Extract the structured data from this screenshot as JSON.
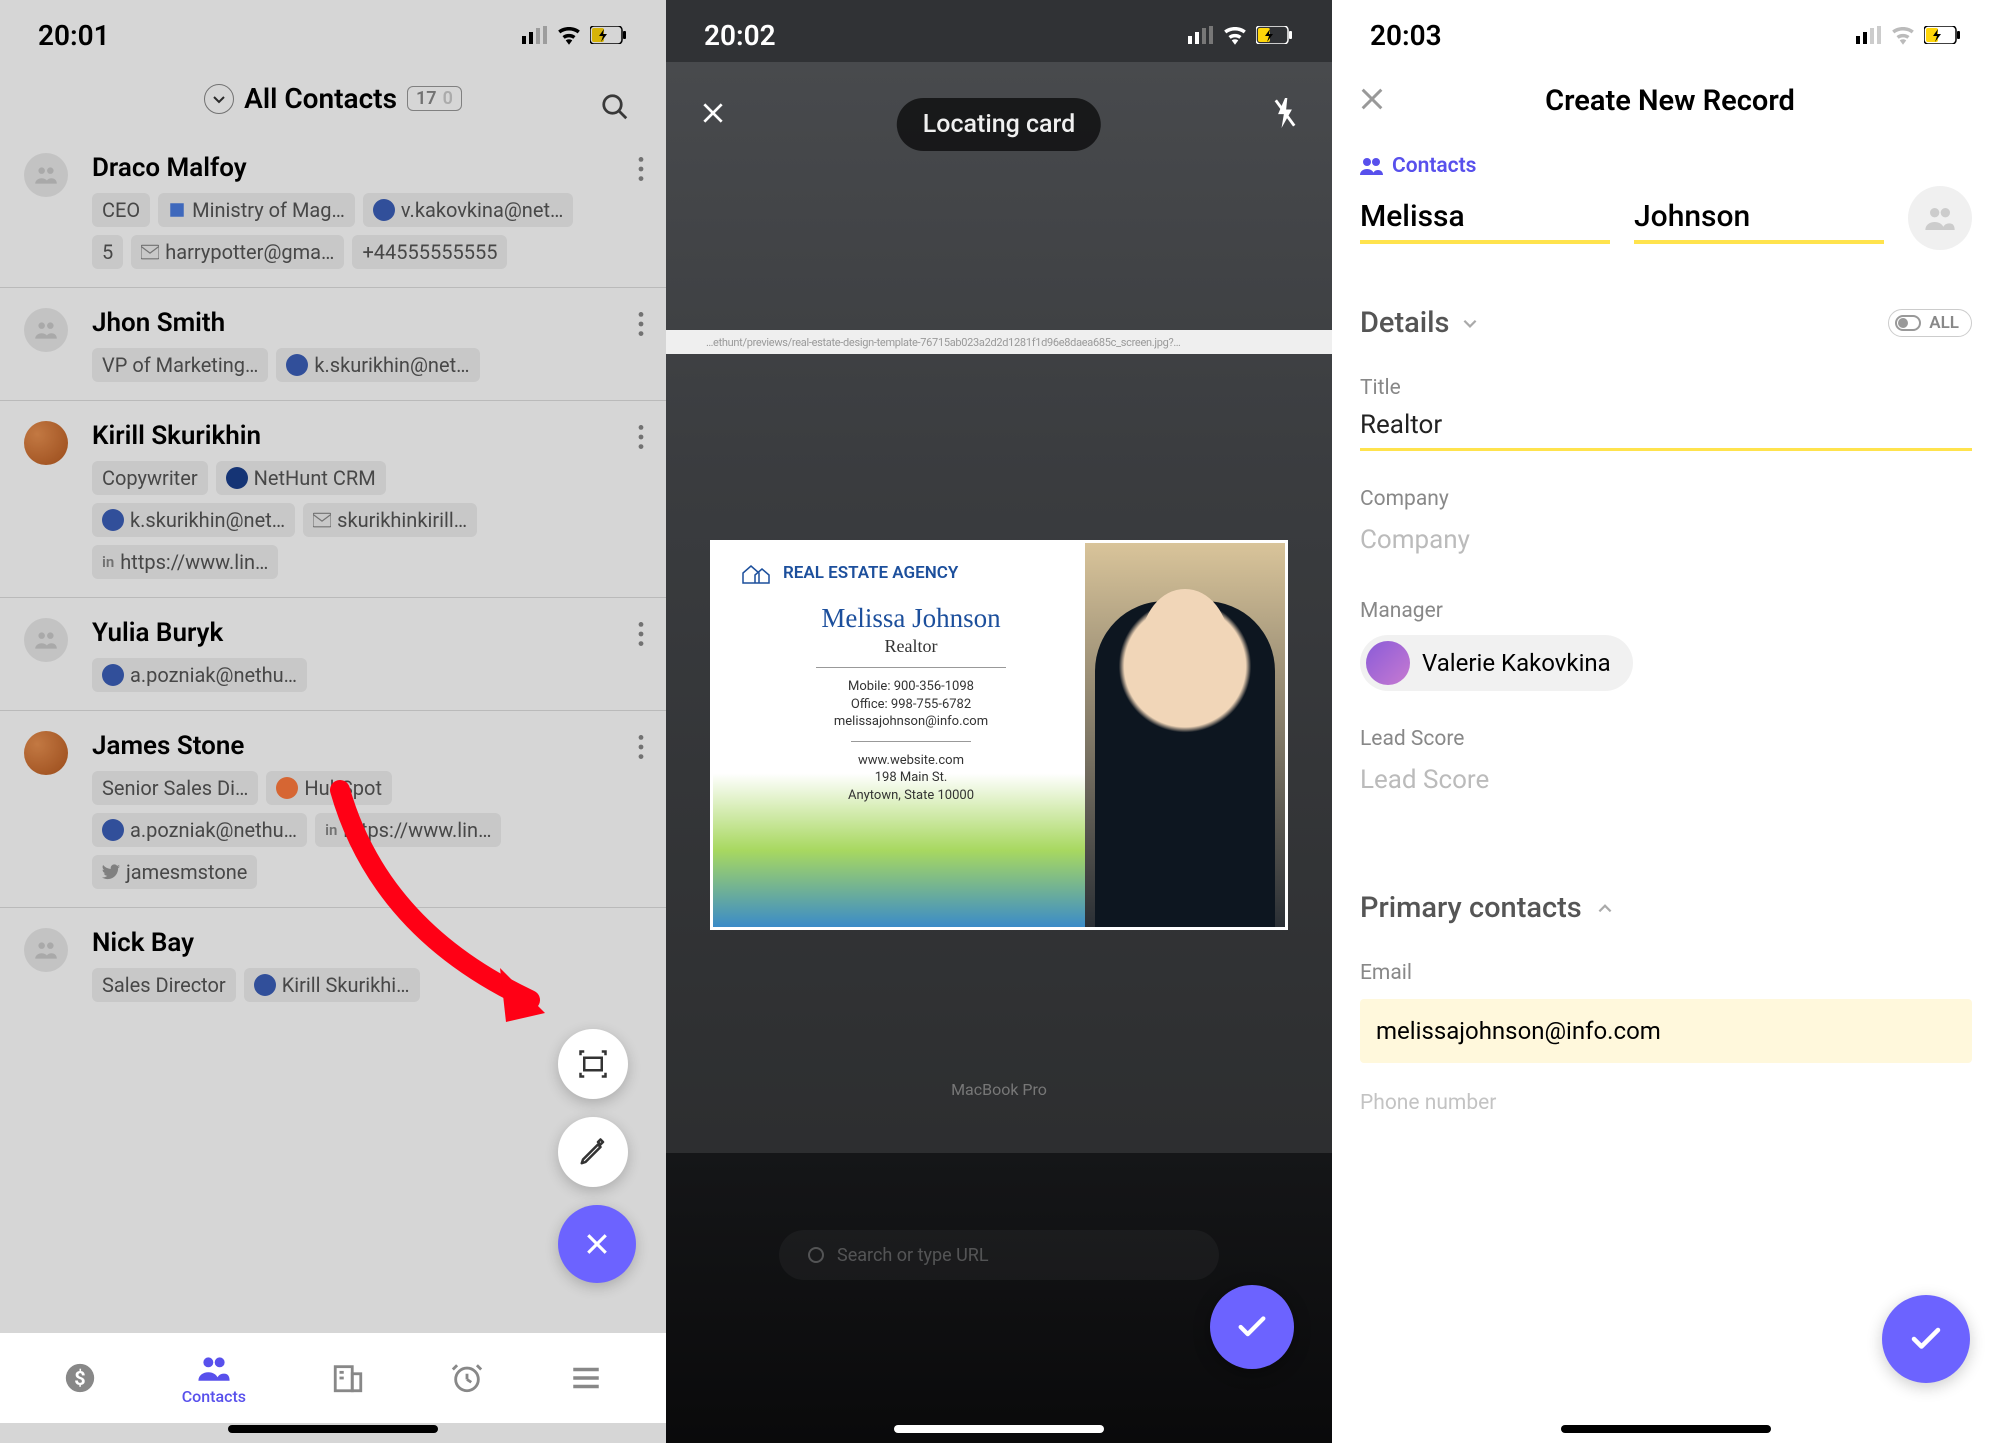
{
  "screen1": {
    "status_time": "20:01",
    "header_title": "All Contacts",
    "count1": "17",
    "count2": "0",
    "nav_label": "Contacts",
    "contacts": [
      {
        "name": "Draco Malfoy",
        "c0": "CEO",
        "c1": "Ministry of Mag…",
        "c2": "v.kakovkina@net…",
        "c3": "5",
        "c4": "harrypotter@gma…",
        "c5": "+44555555555"
      },
      {
        "name": "Jhon Smith",
        "c0": "VP of Marketing…",
        "c1": "k.skurikhin@net…"
      },
      {
        "name": "Kirill Skurikhin",
        "c0": "Copywriter",
        "c1": "NetHunt CRM",
        "c2": "k.skurikhin@net…",
        "c3": "skurikhinkirill…",
        "c4": "https://www.lin…"
      },
      {
        "name": "Yulia Buryk",
        "c0": "a.pozniak@nethu…"
      },
      {
        "name": "James Stone",
        "c0": "Senior Sales Di…",
        "c1": "HubSpot",
        "c2": "a.pozniak@nethu…",
        "c3": "https://www.lin…",
        "c4": "jamesmstone"
      },
      {
        "name": "Nick Bay",
        "c0": "Sales Director",
        "c1": "Kirill Skurikhi…"
      }
    ]
  },
  "screen2": {
    "status_time": "20:02",
    "banner": "Locating card",
    "browser_strip": "…ethunt/previews/real-estate-design-template-76715ab023a2d2d1281f1d96e8daea685c_screen.jpg?…",
    "card": {
      "agency": "REAL ESTATE AGENCY",
      "name": "Melissa Johnson",
      "role": "Realtor",
      "mobile": "Mobile: 900-356-1098",
      "office": "Office: 998-755-6782",
      "email": "melissajohnson@info.com",
      "web": "www.website.com",
      "addr1": "198 Main St.",
      "addr2": "Anytown, State 10000"
    },
    "macbook": "MacBook Pro",
    "url_placeholder": "Search or type URL"
  },
  "screen3": {
    "status_time": "20:03",
    "title": "Create New Record",
    "folder": "Contacts",
    "first_name": "Melissa",
    "last_name": "Johnson",
    "section_details": "Details",
    "all_label": "ALL",
    "label_title": "Title",
    "value_title": "Realtor",
    "label_company": "Company",
    "placeholder_company": "Company",
    "label_manager": "Manager",
    "value_manager": "Valerie Kakovkina",
    "label_leadscore": "Lead Score",
    "placeholder_leadscore": "Lead Score",
    "section_primary": "Primary contacts",
    "label_email": "Email",
    "value_email": "melissajohnson@info.com",
    "label_phone": "Phone number"
  }
}
